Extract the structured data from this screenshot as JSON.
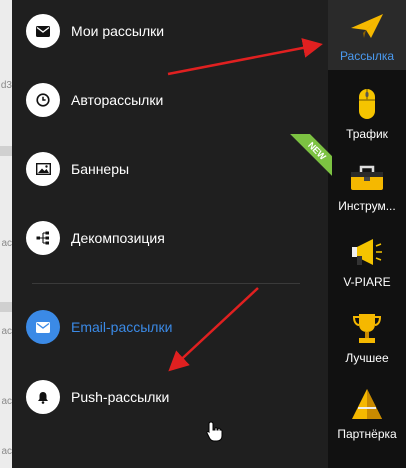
{
  "background_fragments": [
    "d3",
    "ac",
    "ac",
    "ac",
    "ac"
  ],
  "menu": {
    "items": [
      {
        "label": "Мои рассылки",
        "icon": "envelope-icon"
      },
      {
        "label": "Авторассылки",
        "icon": "clock-icon"
      },
      {
        "label": "Баннеры",
        "icon": "image-icon"
      },
      {
        "label": "Декомпозиция",
        "icon": "sitemap-icon"
      },
      {
        "label": "Email-рассылки",
        "icon": "envelope-icon",
        "active": true
      },
      {
        "label": "Push-рассылки",
        "icon": "bell-icon"
      }
    ]
  },
  "right_nav": {
    "items": [
      {
        "label": "Рассылка",
        "icon": "paper-plane-icon",
        "active": true
      },
      {
        "label": "Трафик",
        "icon": "mouse-icon"
      },
      {
        "label": "Инструм...",
        "icon": "toolbox-icon"
      },
      {
        "label": "V-PIARE",
        "icon": "megaphone-icon"
      },
      {
        "label": "Лучшее",
        "icon": "trophy-icon"
      },
      {
        "label": "Партнёрка",
        "icon": "pyramid-icon"
      }
    ],
    "new_badge": "NEW"
  },
  "colors": {
    "menu_background": "#1f1f1f",
    "nav_background": "#111111",
    "accent_blue": "#3b8ae6",
    "arrow_red": "#e02020",
    "new_green": "#7cc242"
  }
}
